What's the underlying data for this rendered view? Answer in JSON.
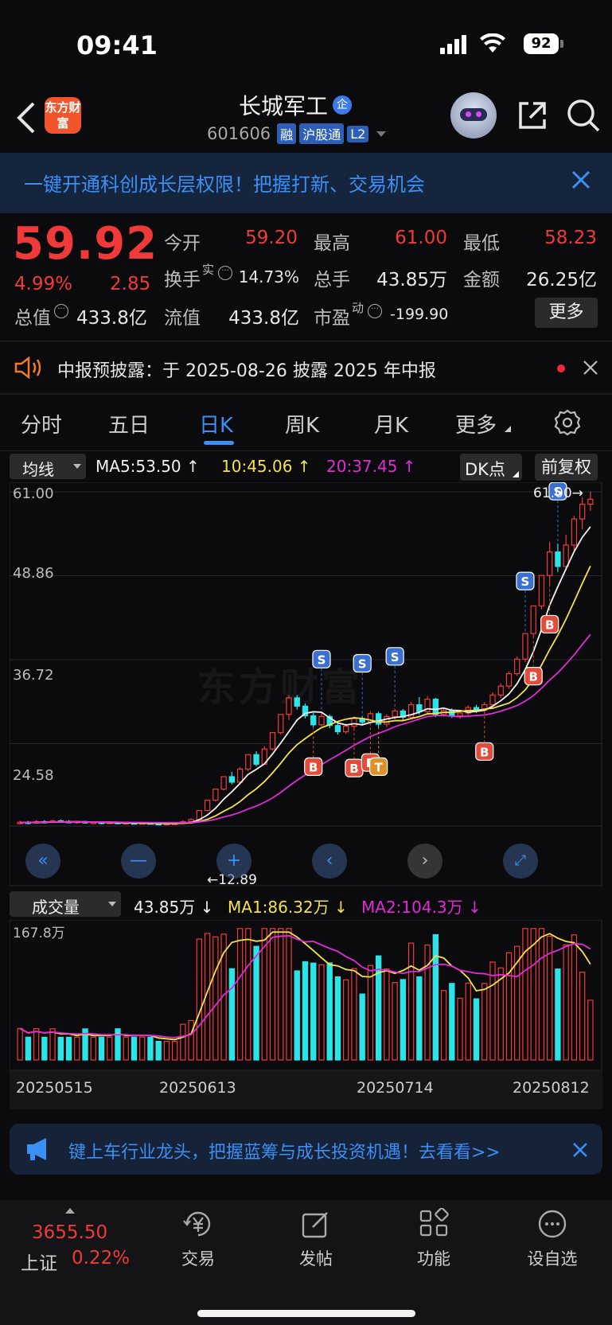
{
  "status_bar": {
    "time": "09:41",
    "battery": "92"
  },
  "header": {
    "logo_text": "东方财富",
    "title": "长城军工",
    "title_badge": "企",
    "code": "601606",
    "tags": [
      "融",
      "沪股通",
      "L2"
    ]
  },
  "promo_banner": {
    "text": "一键开通科创成长层权限！把握打新、交易机会"
  },
  "quote": {
    "price": "59.92",
    "change_pct": "4.99%",
    "change": "2.85",
    "fields": [
      {
        "label": "今开",
        "value": "59.20",
        "color": "#f03a3a"
      },
      {
        "label": "最高",
        "value": "61.00",
        "color": "#f03a3a"
      },
      {
        "label": "最低",
        "value": "58.23",
        "color": "#f03a3a"
      },
      {
        "label": "换手",
        "sup": "实",
        "value": "14.73%",
        "color": "#e6e6e6"
      },
      {
        "label": "总手",
        "value": "43.85万",
        "color": "#e6e6e6"
      },
      {
        "label": "金额",
        "value": "26.25亿",
        "color": "#e6e6e6"
      },
      {
        "label": "总值",
        "value": "433.8亿",
        "color": "#e6e6e6"
      },
      {
        "label": "流值",
        "value": "433.8亿",
        "color": "#e6e6e6"
      },
      {
        "label": "市盈",
        "sup": "动",
        "value": "-199.90",
        "color": "#e6e6e6"
      }
    ],
    "more_label": "更多"
  },
  "notice": {
    "text": "中报预披露：于 2025-08-26 披露 2025 年中报"
  },
  "tabs": {
    "items": [
      "分时",
      "五日",
      "日K",
      "周K",
      "月K",
      "更多"
    ],
    "active": 2
  },
  "kline": {
    "indicator_select": "均线",
    "ma5": "MA5:53.50",
    "ma10": "10:45.06",
    "ma20": "20:37.45",
    "dk_label": "DK点",
    "fq_label": "前复权",
    "y_labels": [
      "61.00",
      "48.86",
      "36.72",
      "24.58"
    ],
    "high_marker": "61.00",
    "low_marker": "12.89"
  },
  "volume": {
    "select": "成交量",
    "vol": "43.85万",
    "ma1": "MA1:86.32万",
    "ma2": "MA2:104.3万",
    "max_label": "167.8万",
    "dates": [
      "20250515",
      "20250613",
      "20250714",
      "20250812"
    ]
  },
  "ad_banner": {
    "text": "键上车行业龙头，把握蓝筹与成长投资机遇！去看看>>"
  },
  "bottom_nav": {
    "index_value": "3655.50",
    "index_name": "上证",
    "index_pct": "0.22%",
    "items": [
      "交易",
      "发帖",
      "功能",
      "设自选"
    ]
  },
  "chart_data": {
    "type": "candlestick",
    "price_ylim": [
      12.89,
      61.0
    ],
    "price": [
      {
        "o": 13.0,
        "c": 13.2,
        "h": 13.4,
        "l": 12.9
      },
      {
        "o": 13.2,
        "c": 13.1,
        "h": 13.4,
        "l": 12.9
      },
      {
        "o": 13.1,
        "c": 13.3,
        "h": 13.5,
        "l": 13.0
      },
      {
        "o": 13.3,
        "c": 13.2,
        "h": 13.5,
        "l": 13.0
      },
      {
        "o": 13.2,
        "c": 13.4,
        "h": 13.6,
        "l": 13.1
      },
      {
        "o": 13.4,
        "c": 13.3,
        "h": 13.6,
        "l": 13.2
      },
      {
        "o": 13.3,
        "c": 13.2,
        "h": 13.5,
        "l": 13.1
      },
      {
        "o": 13.2,
        "c": 13.3,
        "h": 13.4,
        "l": 13.0
      },
      {
        "o": 13.3,
        "c": 13.1,
        "h": 13.4,
        "l": 13.0
      },
      {
        "o": 13.1,
        "c": 13.2,
        "h": 13.3,
        "l": 12.9
      },
      {
        "o": 13.2,
        "c": 13.1,
        "h": 13.3,
        "l": 12.9
      },
      {
        "o": 13.1,
        "c": 13.2,
        "h": 13.3,
        "l": 13.0
      },
      {
        "o": 13.2,
        "c": 13.0,
        "h": 13.3,
        "l": 12.9
      },
      {
        "o": 13.0,
        "c": 13.1,
        "h": 13.2,
        "l": 12.9
      },
      {
        "o": 13.1,
        "c": 13.0,
        "h": 13.2,
        "l": 12.9
      },
      {
        "o": 13.0,
        "c": 13.1,
        "h": 13.2,
        "l": 12.9
      },
      {
        "o": 13.1,
        "c": 13.0,
        "h": 13.2,
        "l": 12.9
      },
      {
        "o": 13.0,
        "c": 12.95,
        "h": 13.1,
        "l": 12.89
      },
      {
        "o": 12.95,
        "c": 13.0,
        "h": 13.1,
        "l": 12.89
      },
      {
        "o": 13.0,
        "c": 13.05,
        "h": 13.2,
        "l": 12.9
      },
      {
        "o": 13.05,
        "c": 13.3,
        "h": 13.5,
        "l": 13.0
      },
      {
        "o": 13.3,
        "c": 13.6,
        "h": 13.8,
        "l": 13.2
      },
      {
        "o": 13.6,
        "c": 14.9,
        "h": 14.9,
        "l": 13.6
      },
      {
        "o": 14.9,
        "c": 16.4,
        "h": 16.4,
        "l": 14.8
      },
      {
        "o": 16.4,
        "c": 18.0,
        "h": 18.0,
        "l": 16.2
      },
      {
        "o": 18.0,
        "c": 19.8,
        "h": 19.8,
        "l": 17.8
      },
      {
        "o": 19.8,
        "c": 19.0,
        "h": 20.5,
        "l": 18.7
      },
      {
        "o": 19.0,
        "c": 20.9,
        "h": 21.2,
        "l": 18.8
      },
      {
        "o": 20.9,
        "c": 22.99,
        "h": 22.99,
        "l": 20.6
      },
      {
        "o": 22.99,
        "c": 21.6,
        "h": 23.5,
        "l": 21.3
      },
      {
        "o": 21.6,
        "c": 23.8,
        "h": 24.2,
        "l": 21.5
      },
      {
        "o": 23.8,
        "c": 26.18,
        "h": 26.18,
        "l": 23.6
      },
      {
        "o": 26.18,
        "c": 28.8,
        "h": 28.8,
        "l": 25.9
      },
      {
        "o": 28.8,
        "c": 31.2,
        "h": 31.6,
        "l": 28.0
      },
      {
        "o": 31.2,
        "c": 30.0,
        "h": 31.6,
        "l": 29.5
      },
      {
        "o": 30.0,
        "c": 28.6,
        "h": 30.4,
        "l": 28.2
      },
      {
        "o": 28.6,
        "c": 27.3,
        "h": 29.0,
        "l": 27.0
      },
      {
        "o": 27.3,
        "c": 28.5,
        "h": 29.2,
        "l": 27.1
      },
      {
        "o": 28.5,
        "c": 27.2,
        "h": 28.8,
        "l": 26.8
      },
      {
        "o": 27.2,
        "c": 26.3,
        "h": 27.5,
        "l": 25.9
      },
      {
        "o": 26.3,
        "c": 27.1,
        "h": 27.5,
        "l": 26.0
      },
      {
        "o": 27.1,
        "c": 28.2,
        "h": 28.5,
        "l": 26.8
      },
      {
        "o": 28.2,
        "c": 27.7,
        "h": 28.6,
        "l": 27.2
      },
      {
        "o": 27.7,
        "c": 28.9,
        "h": 29.2,
        "l": 27.6
      },
      {
        "o": 28.9,
        "c": 27.4,
        "h": 29.2,
        "l": 27.0
      },
      {
        "o": 27.4,
        "c": 28.5,
        "h": 28.8,
        "l": 27.0
      },
      {
        "o": 28.5,
        "c": 29.3,
        "h": 29.6,
        "l": 28.1
      },
      {
        "o": 29.3,
        "c": 28.4,
        "h": 29.6,
        "l": 28.0
      },
      {
        "o": 28.4,
        "c": 30.2,
        "h": 30.6,
        "l": 28.2
      },
      {
        "o": 30.2,
        "c": 29.2,
        "h": 31.3,
        "l": 28.8
      },
      {
        "o": 29.2,
        "c": 31.0,
        "h": 31.4,
        "l": 28.8
      },
      {
        "o": 31.0,
        "c": 28.8,
        "h": 31.2,
        "l": 28.4
      },
      {
        "o": 28.8,
        "c": 29.4,
        "h": 29.8,
        "l": 28.5
      },
      {
        "o": 29.4,
        "c": 28.6,
        "h": 29.7,
        "l": 28.3
      },
      {
        "o": 28.6,
        "c": 29.0,
        "h": 29.3,
        "l": 28.2
      },
      {
        "o": 29.0,
        "c": 29.8,
        "h": 30.1,
        "l": 28.7
      },
      {
        "o": 29.8,
        "c": 29.4,
        "h": 30.2,
        "l": 29.0
      },
      {
        "o": 29.4,
        "c": 30.2,
        "h": 30.6,
        "l": 29.2
      },
      {
        "o": 30.2,
        "c": 31.6,
        "h": 32.0,
        "l": 29.8
      },
      {
        "o": 31.6,
        "c": 32.9,
        "h": 33.3,
        "l": 31.2
      },
      {
        "o": 32.9,
        "c": 34.7,
        "h": 35.0,
        "l": 32.5
      },
      {
        "o": 34.7,
        "c": 36.8,
        "h": 37.2,
        "l": 34.4
      },
      {
        "o": 36.8,
        "c": 40.5,
        "h": 40.5,
        "l": 36.4
      },
      {
        "o": 40.5,
        "c": 44.5,
        "h": 44.5,
        "l": 40.1
      },
      {
        "o": 44.5,
        "c": 48.9,
        "h": 48.9,
        "l": 44.0
      },
      {
        "o": 48.9,
        "c": 52.3,
        "h": 53.8,
        "l": 47.6
      },
      {
        "o": 52.3,
        "c": 50.2,
        "h": 53.5,
        "l": 49.4
      },
      {
        "o": 50.2,
        "c": 53.3,
        "h": 54.8,
        "l": 49.6
      },
      {
        "o": 53.3,
        "c": 57.07,
        "h": 57.5,
        "l": 52.5
      },
      {
        "o": 57.07,
        "c": 59.2,
        "h": 60.2,
        "l": 55.6
      },
      {
        "o": 59.2,
        "c": 59.92,
        "h": 61.0,
        "l": 58.23
      }
    ],
    "ma5": "computed",
    "volume_ylim": [
      0,
      167.8
    ],
    "volume_unit": "万",
    "trade_signals": [
      {
        "type": "S",
        "index": 37
      },
      {
        "type": "S",
        "index": 42
      },
      {
        "type": "S",
        "index": 46
      },
      {
        "type": "B",
        "index": 36
      },
      {
        "type": "B",
        "index": 41
      },
      {
        "type": "B",
        "index": 43
      },
      {
        "type": "T",
        "index": 44
      },
      {
        "type": "B",
        "index": 57
      },
      {
        "type": "B",
        "index": 63
      },
      {
        "type": "B",
        "index": 65
      },
      {
        "type": "S",
        "index": 62
      },
      {
        "type": "S",
        "index": 66
      }
    ]
  }
}
